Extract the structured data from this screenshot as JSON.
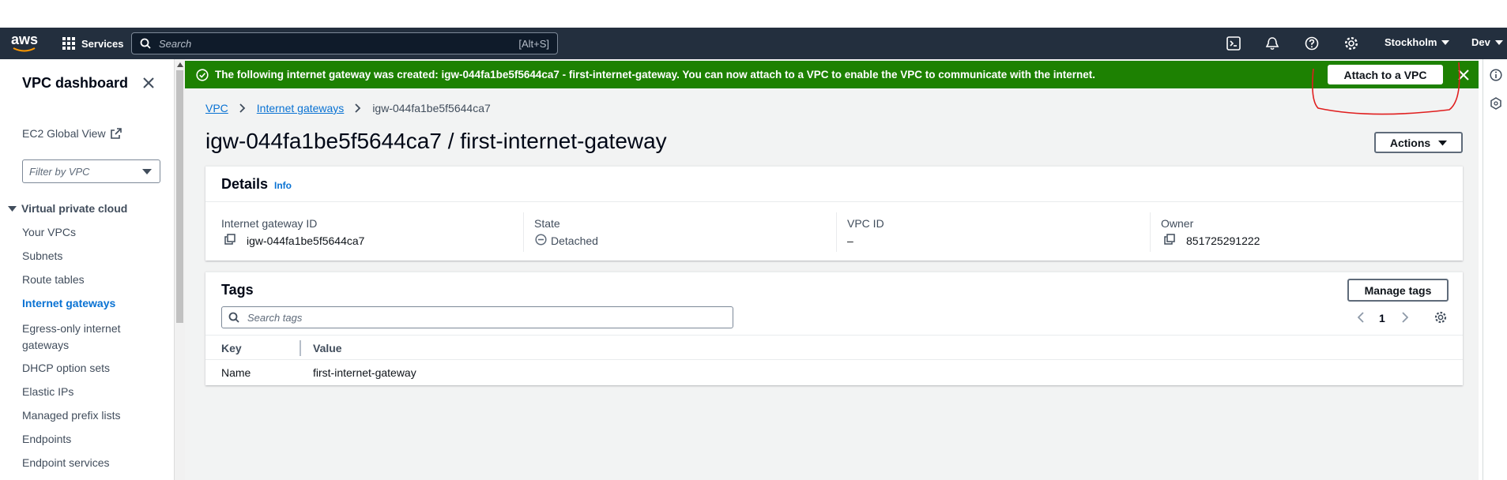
{
  "top_nav": {
    "logo": "aws",
    "services_label": "Services",
    "search_placeholder": "Search",
    "search_shortcut": "[Alt+S]",
    "region": "Stockholm",
    "account": "Dev",
    "icons": [
      "cloudshell-icon",
      "bell-icon",
      "help-icon",
      "gear-icon"
    ]
  },
  "sidebar": {
    "title": "VPC dashboard",
    "ec2_global_view": "EC2 Global View",
    "filter_placeholder": "Filter by VPC",
    "section_title": "Virtual private cloud",
    "items": [
      {
        "label": "Your VPCs",
        "active": false
      },
      {
        "label": "Subnets",
        "active": false
      },
      {
        "label": "Route tables",
        "active": false
      },
      {
        "label": "Internet gateways",
        "active": true
      },
      {
        "label": "Egress-only internet gateways",
        "active": false
      },
      {
        "label": "DHCP option sets",
        "active": false
      },
      {
        "label": "Elastic IPs",
        "active": false
      },
      {
        "label": "Managed prefix lists",
        "active": false
      },
      {
        "label": "Endpoints",
        "active": false
      },
      {
        "label": "Endpoint services",
        "active": false
      }
    ]
  },
  "flash": {
    "message": "The following internet gateway was created: igw-044fa1be5f5644ca7 - first-internet-gateway. You can now attach to a VPC to enable the VPC to communicate with the internet.",
    "action_label": "Attach to a VPC",
    "color": "#1d8102"
  },
  "breadcrumb": {
    "items": [
      "VPC",
      "Internet gateways",
      "igw-044fa1be5f5644ca7"
    ]
  },
  "page": {
    "title": "igw-044fa1be5f5644ca7 / first-internet-gateway",
    "actions_label": "Actions"
  },
  "details": {
    "heading": "Details",
    "info_label": "Info",
    "fields": [
      {
        "label": "Internet gateway ID",
        "value": "igw-044fa1be5f5644ca7"
      },
      {
        "label": "State",
        "value": "Detached"
      },
      {
        "label": "VPC ID",
        "value": "–"
      },
      {
        "label": "Owner",
        "value": "851725291222"
      }
    ]
  },
  "tags": {
    "heading": "Tags",
    "manage_label": "Manage tags",
    "search_placeholder": "Search tags",
    "page_number": "1",
    "columns": [
      "Key",
      "Value"
    ],
    "rows": [
      {
        "key": "Name",
        "value": "first-internet-gateway"
      }
    ]
  }
}
